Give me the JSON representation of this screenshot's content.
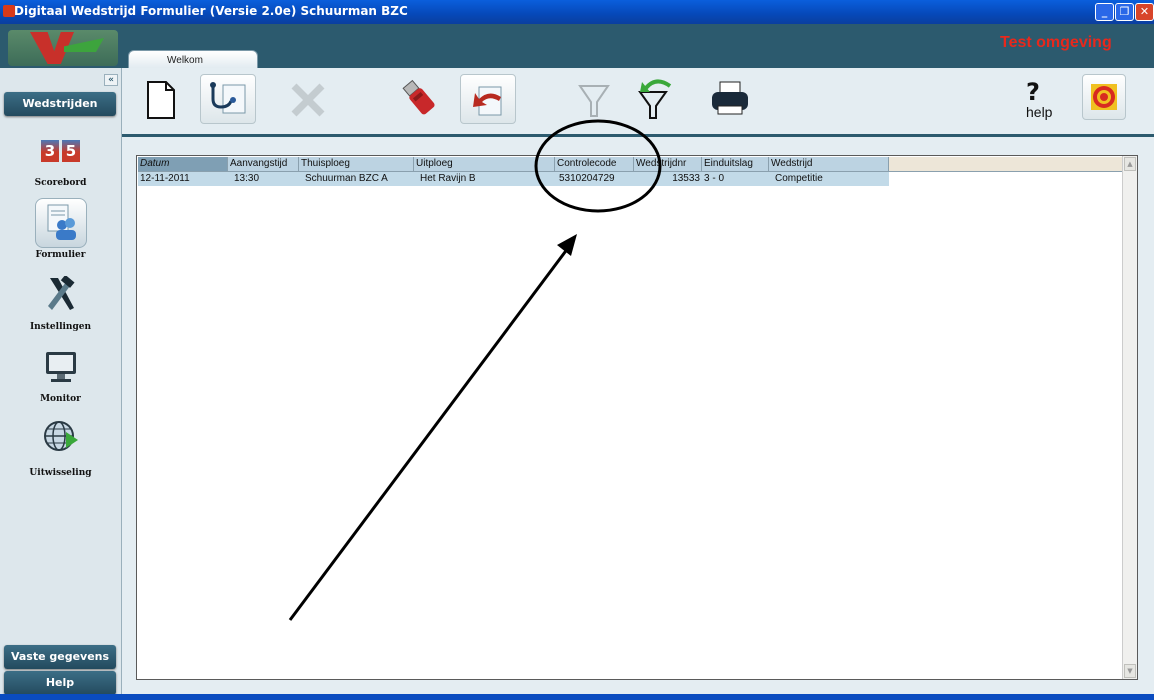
{
  "window": {
    "title": "Digitaal Wedstrijd Formulier  (Versie 2.0e) Schuurman BZC",
    "min": "_",
    "max": "❐",
    "close": "✕"
  },
  "header": {
    "tab_label": "Welkom",
    "environment_label": "Test omgeving"
  },
  "sidebar": {
    "collapse": "«",
    "top_button": "Wedstrijden",
    "items": [
      {
        "label": "Scorebord",
        "icon": "scoreboard-icon"
      },
      {
        "label": "Formulier",
        "icon": "form-icon"
      },
      {
        "label": "Instellingen",
        "icon": "tools-icon"
      },
      {
        "label": "Monitor",
        "icon": "monitor-icon"
      },
      {
        "label": "Uitwisseling",
        "icon": "globe-exchange-icon"
      }
    ],
    "scoreboard_digits": [
      "3",
      "5"
    ],
    "bottom_buttons": [
      "Vaste gegevens",
      "Help"
    ]
  },
  "toolbar": {
    "buttons": [
      "new-document-icon",
      "form-stethoscope-icon",
      "delete-icon",
      "usb-icon",
      "import-icon",
      "filter-icon",
      "filter-reset-icon",
      "print-icon",
      "help-icon",
      "target-icon"
    ],
    "help_label": "help"
  },
  "table": {
    "columns": [
      "Datum",
      "Aanvangstijd",
      "Thuisploeg",
      "Uitploeg",
      "Controlecode",
      "Wedstrijdnr",
      "Einduitslag",
      "Wedstrijd"
    ],
    "rows": [
      [
        "12-11-2011",
        "13:30",
        "Schuurman BZC A",
        "Het Ravijn B",
        "5310204729",
        "13533",
        "3 - 0",
        "Competitie"
      ]
    ]
  },
  "colors": {
    "title_bar": "#0a5fdc",
    "header_band": "#2c5a6e",
    "environment_text": "#e8281c",
    "row_highlight": "#c2dae8"
  }
}
